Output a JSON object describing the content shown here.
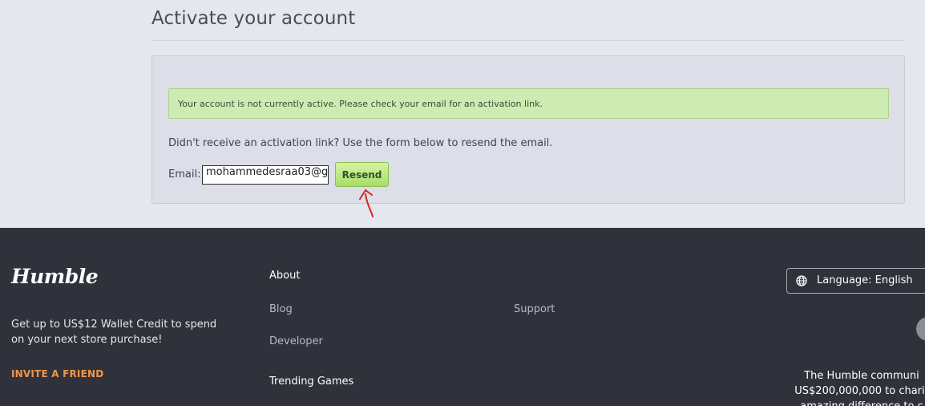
{
  "page": {
    "title": "Activate your account"
  },
  "alert": {
    "message": "Your account is not currently active. Please check your email for an activation link."
  },
  "resend_form": {
    "instructions": "Didn't receive an activation link? Use the form below to resend the email.",
    "email_label": "Email:",
    "email_value": "mohammedesraa03@g",
    "button_label": "Resend"
  },
  "footer": {
    "logo": "Humble",
    "promo_text": "Get up to US$12 Wallet Credit to spend on your next store purchase!",
    "invite_label": "INVITE A FRIEND",
    "links": {
      "about": "About",
      "blog": "Blog",
      "developer": "Developer",
      "trending": "Trending Games",
      "support": "Support"
    },
    "language_label": "Language: English",
    "community_line1": "The Humble communi",
    "community_line2": "US$200,000,000 to charit",
    "community_line3": "amazing difference to c"
  },
  "colors": {
    "background": "#e5e7ef",
    "alert_bg": "#cdebb2",
    "button_green": "#a8dc6a",
    "footer_bg": "#2f323b",
    "invite_orange": "#f2954b",
    "annotation_red": "#e02020"
  },
  "icons": {
    "language": "globe-icon",
    "annotation": "red-arrow-annotation"
  }
}
